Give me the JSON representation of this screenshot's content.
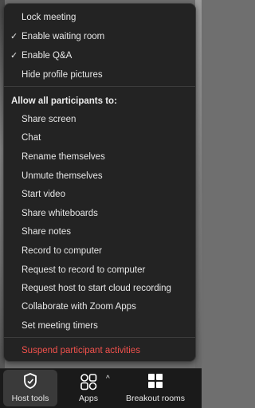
{
  "menu": {
    "items_top": [
      {
        "label": "Lock meeting",
        "checked": false
      },
      {
        "label": "Enable waiting room",
        "checked": true
      },
      {
        "label": "Enable Q&A",
        "checked": true
      },
      {
        "label": "Hide profile pictures",
        "checked": false
      }
    ],
    "header": "Allow all participants to:",
    "items_allow": [
      {
        "label": "Share screen"
      },
      {
        "label": "Chat"
      },
      {
        "label": "Rename themselves"
      },
      {
        "label": "Unmute themselves"
      },
      {
        "label": "Start video"
      },
      {
        "label": "Share whiteboards"
      },
      {
        "label": "Share notes"
      },
      {
        "label": "Record to computer"
      },
      {
        "label": "Request to record to computer"
      },
      {
        "label": "Request host to start cloud recording"
      },
      {
        "label": "Collaborate with Zoom Apps"
      },
      {
        "label": "Set meeting timers"
      }
    ],
    "suspend_label": "Suspend participant activities",
    "check_glyph": "✓"
  },
  "toolbar": {
    "host_tools": {
      "label": "Host tools",
      "icon": "shield-icon"
    },
    "apps": {
      "label": "Apps",
      "icon": "apps-icon"
    },
    "apps_caret": "^",
    "breakout_rooms": {
      "label": "Breakout rooms",
      "icon": "grid-icon"
    }
  },
  "colors": {
    "danger": "#f0514c",
    "menu_bg": "#232323",
    "toolbar_bg": "#1a1a1a"
  }
}
